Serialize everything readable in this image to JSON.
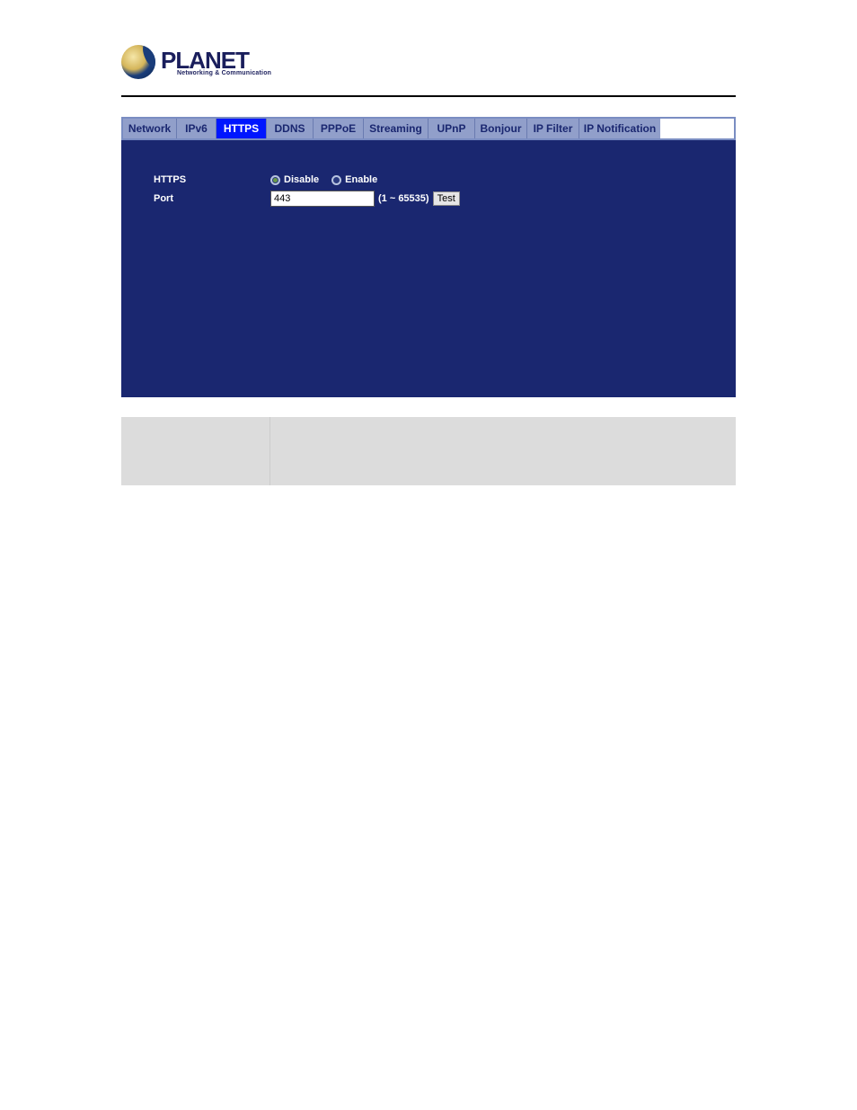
{
  "logo": {
    "main": "PLANET",
    "sub": "Networking & Communication"
  },
  "tabs": [
    {
      "id": "network",
      "label": "Network",
      "active": false
    },
    {
      "id": "ipv6",
      "label": "IPv6",
      "active": false
    },
    {
      "id": "https",
      "label": "HTTPS",
      "active": true
    },
    {
      "id": "ddns",
      "label": "DDNS",
      "active": false
    },
    {
      "id": "pppoe",
      "label": "PPPoE",
      "active": false
    },
    {
      "id": "streaming",
      "label": "Streaming",
      "active": false
    },
    {
      "id": "upnp",
      "label": "UPnP",
      "active": false
    },
    {
      "id": "bonjour",
      "label": "Bonjour",
      "active": false
    },
    {
      "id": "ipfilter",
      "label": "IP Filter",
      "active": false
    },
    {
      "id": "ipnotif",
      "label": "IP Notification",
      "active": false
    }
  ],
  "form": {
    "https_label": "HTTPS",
    "port_label": "Port",
    "disable_label": "Disable",
    "enable_label": "Enable",
    "https_value": "disable",
    "port_value": "443",
    "port_range": "(1 ~ 65535)",
    "test_label": "Test"
  }
}
